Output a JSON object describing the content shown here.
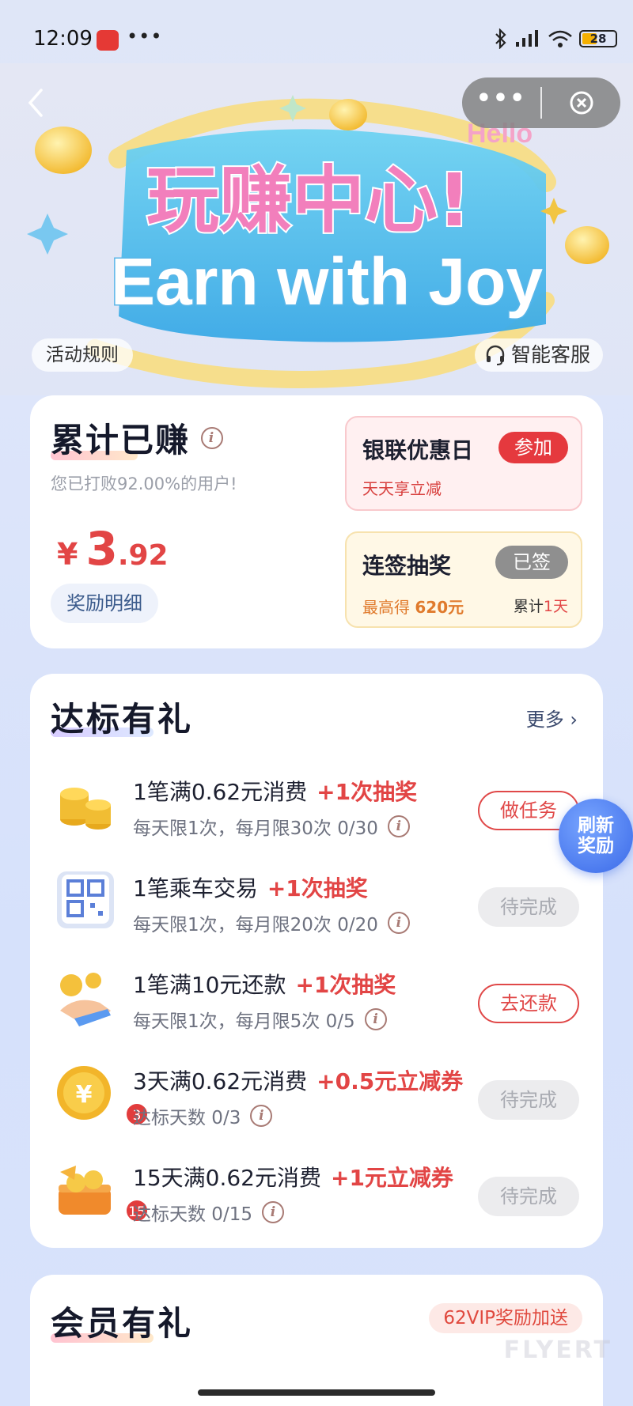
{
  "status_bar": {
    "time": "12:09",
    "dots": "•••",
    "battery": "28"
  },
  "banner": {
    "title_cn": "玩赚中心!",
    "title_en": "Earn with Joy",
    "hello": "Hello",
    "rules_label": "活动规则",
    "service_label": "智能客服"
  },
  "capsule": {
    "more": "•••"
  },
  "earned": {
    "title": "累计已赚",
    "subtitle": "您已打败92.00%的用户!",
    "currency": "¥",
    "amount_int": "3",
    "amount_dec": ".92",
    "detail_button": "奖励明细"
  },
  "promos": {
    "unionpay": {
      "title": "银联优惠日",
      "button": "参加",
      "subtitle": "天天享立减"
    },
    "checkin": {
      "title": "连签抽奖",
      "button": "已签",
      "subtitle_prefix": "最高得",
      "subtitle_value": "620元",
      "count_prefix": "累计",
      "count_value": "1天"
    }
  },
  "tasks_section": {
    "title": "达标有礼",
    "more": "更多 ›",
    "items": [
      {
        "title": "1笔满0.62元消费",
        "reward": "+1次抽奖",
        "meta": "每天限1次，每月限30次 0/30",
        "button": "做任务"
      },
      {
        "title": "1笔乘车交易",
        "reward": "+1次抽奖",
        "meta": "每天限1次，每月限20次 0/20",
        "button": "待完成"
      },
      {
        "title": "1笔满10元还款",
        "reward": "+1次抽奖",
        "meta": "每天限1次，每月限5次 0/5",
        "button": "去还款"
      },
      {
        "title": "3天满0.62元消费",
        "reward": "+0.5元立减券",
        "meta": "达标天数 0/3",
        "button": "待完成",
        "badge": "3"
      },
      {
        "title": "15天满0.62元消费",
        "reward": "+1元立减券",
        "meta": "达标天数 0/15",
        "button": "待完成",
        "badge": "15"
      }
    ]
  },
  "refresh_float": {
    "line1": "刷新",
    "line2": "奖励"
  },
  "member_section": {
    "title": "会员有礼",
    "vip_tag": "62VIP奖励加送"
  },
  "watermark": "FLYERT",
  "colors": {
    "accent_red": "#e24545",
    "float_blue": "#3a69e8"
  }
}
